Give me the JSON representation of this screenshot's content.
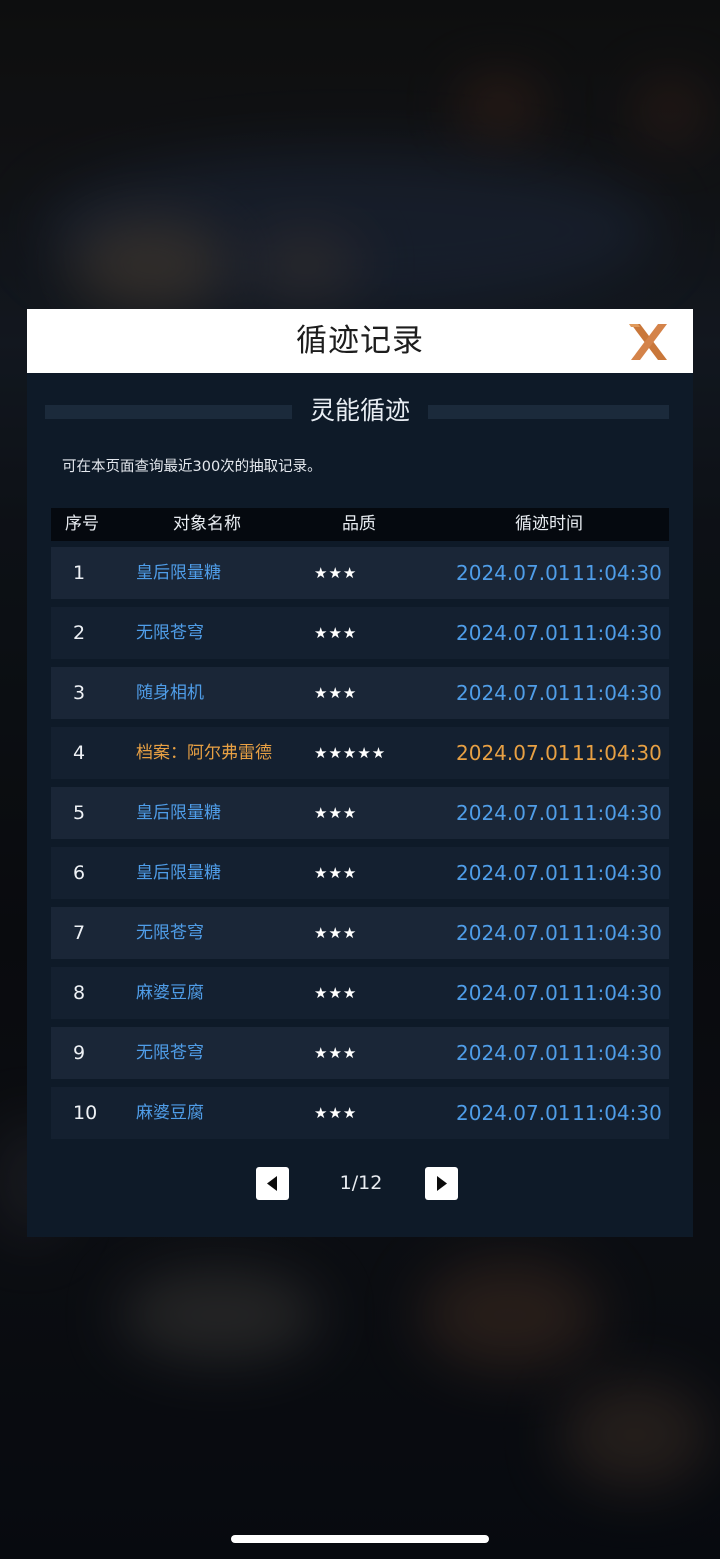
{
  "dialog": {
    "title": "循迹记录",
    "subtitle": "灵能循迹",
    "note": "可在本页面查询最近300次的抽取记录。"
  },
  "table": {
    "headers": [
      "序号",
      "对象名称",
      "品质",
      "循迹时间"
    ],
    "rows": [
      {
        "index": "1",
        "name": "皇后限量糖",
        "stars": "★★★",
        "date": "2024.07.01",
        "time": "11:04:30"
      },
      {
        "index": "2",
        "name": "无限苍穹",
        "stars": "★★★",
        "date": "2024.07.01",
        "time": "11:04:30"
      },
      {
        "index": "3",
        "name": "随身相机",
        "stars": "★★★",
        "date": "2024.07.01",
        "time": "11:04:30"
      },
      {
        "index": "4",
        "name": "档案：阿尔弗雷德",
        "stars": "★★★★★",
        "date": "2024.07.01",
        "time": "11:04:30"
      },
      {
        "index": "5",
        "name": "皇后限量糖",
        "stars": "★★★",
        "date": "2024.07.01",
        "time": "11:04:30"
      },
      {
        "index": "6",
        "name": "皇后限量糖",
        "stars": "★★★",
        "date": "2024.07.01",
        "time": "11:04:30"
      },
      {
        "index": "7",
        "name": "无限苍穹",
        "stars": "★★★",
        "date": "2024.07.01",
        "time": "11:04:30"
      },
      {
        "index": "8",
        "name": "麻婆豆腐",
        "stars": "★★★",
        "date": "2024.07.01",
        "time": "11:04:30"
      },
      {
        "index": "9",
        "name": "无限苍穹",
        "stars": "★★★",
        "date": "2024.07.01",
        "time": "11:04:30"
      },
      {
        "index": "10",
        "name": "麻婆豆腐",
        "stars": "★★★",
        "date": "2024.07.01",
        "time": "11:04:30"
      }
    ]
  },
  "pager": {
    "page": "1/12",
    "prev_icon": "triangle-left-icon",
    "next_icon": "triangle-right-icon"
  },
  "icons": {
    "close": "close-x-icon"
  },
  "colors": {
    "accent_blue": "#4f9de8",
    "highlight_gold": "#e8a043",
    "close_orange": "#c9773a",
    "panel_bg": "#0e1a28"
  }
}
